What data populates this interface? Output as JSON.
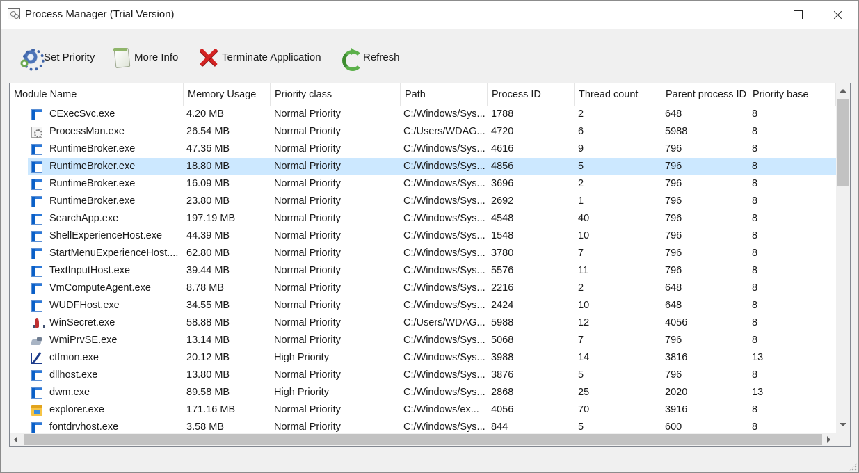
{
  "window": {
    "title": "Process Manager (Trial Version)"
  },
  "toolbar": {
    "set_priority": "Set Priority",
    "more_info": "More Info",
    "terminate": "Terminate Application",
    "refresh": "Refresh"
  },
  "columns": [
    "Module Name",
    "Memory Usage",
    "Priority class",
    "Path",
    "Process ID",
    "Thread count",
    "Parent process ID",
    "Priority base"
  ],
  "selected_row": 3,
  "rows": [
    {
      "icon": "windows-app-icon",
      "name": "CExecSvc.exe",
      "mem": "4.20 MB",
      "prio": "Normal Priority",
      "path": "C:/Windows/Sys...",
      "pid": "1788",
      "threads": "2",
      "ppid": "648",
      "base": "8"
    },
    {
      "icon": "gears-app-icon",
      "name": "ProcessMan.exe",
      "mem": "26.54 MB",
      "prio": "Normal Priority",
      "path": "C:/Users/WDAG...",
      "pid": "4720",
      "threads": "6",
      "ppid": "5988",
      "base": "8"
    },
    {
      "icon": "windows-app-icon",
      "name": "RuntimeBroker.exe",
      "mem": "47.36 MB",
      "prio": "Normal Priority",
      "path": "C:/Windows/Sys...",
      "pid": "4616",
      "threads": "9",
      "ppid": "796",
      "base": "8"
    },
    {
      "icon": "windows-app-icon",
      "name": "RuntimeBroker.exe",
      "mem": "18.80 MB",
      "prio": "Normal Priority",
      "path": "C:/Windows/Sys...",
      "pid": "4856",
      "threads": "5",
      "ppid": "796",
      "base": "8"
    },
    {
      "icon": "windows-app-icon",
      "name": "RuntimeBroker.exe",
      "mem": "16.09 MB",
      "prio": "Normal Priority",
      "path": "C:/Windows/Sys...",
      "pid": "3696",
      "threads": "2",
      "ppid": "796",
      "base": "8"
    },
    {
      "icon": "windows-app-icon",
      "name": "RuntimeBroker.exe",
      "mem": "23.80 MB",
      "prio": "Normal Priority",
      "path": "C:/Windows/Sys...",
      "pid": "2692",
      "threads": "1",
      "ppid": "796",
      "base": "8"
    },
    {
      "icon": "windows-app-icon",
      "name": "SearchApp.exe",
      "mem": "197.19 MB",
      "prio": "Normal Priority",
      "path": "C:/Windows/Sys...",
      "pid": "4548",
      "threads": "40",
      "ppid": "796",
      "base": "8"
    },
    {
      "icon": "windows-app-icon",
      "name": "ShellExperienceHost.exe",
      "mem": "44.39 MB",
      "prio": "Normal Priority",
      "path": "C:/Windows/Sys...",
      "pid": "1548",
      "threads": "10",
      "ppid": "796",
      "base": "8"
    },
    {
      "icon": "windows-app-icon",
      "name": "StartMenuExperienceHost....",
      "mem": "62.80 MB",
      "prio": "Normal Priority",
      "path": "C:/Windows/Sys...",
      "pid": "3780",
      "threads": "7",
      "ppid": "796",
      "base": "8"
    },
    {
      "icon": "windows-app-icon",
      "name": "TextInputHost.exe",
      "mem": "39.44 MB",
      "prio": "Normal Priority",
      "path": "C:/Windows/Sys...",
      "pid": "5576",
      "threads": "11",
      "ppid": "796",
      "base": "8"
    },
    {
      "icon": "windows-app-icon",
      "name": "VmComputeAgent.exe",
      "mem": "8.78 MB",
      "prio": "Normal Priority",
      "path": "C:/Windows/Sys...",
      "pid": "2216",
      "threads": "2",
      "ppid": "648",
      "base": "8"
    },
    {
      "icon": "windows-app-icon",
      "name": "WUDFHost.exe",
      "mem": "34.55 MB",
      "prio": "Normal Priority",
      "path": "C:/Windows/Sys...",
      "pid": "2424",
      "threads": "10",
      "ppid": "648",
      "base": "8"
    },
    {
      "icon": "rocket-icon",
      "name": "WinSecret.exe",
      "mem": "58.88 MB",
      "prio": "Normal Priority",
      "path": "C:/Users/WDAG...",
      "pid": "5988",
      "threads": "12",
      "ppid": "4056",
      "base": "8"
    },
    {
      "icon": "wmi-icon",
      "name": "WmiPrvSE.exe",
      "mem": "13.14 MB",
      "prio": "Normal Priority",
      "path": "C:/Windows/Sys...",
      "pid": "5068",
      "threads": "7",
      "ppid": "796",
      "base": "8"
    },
    {
      "icon": "pen-icon",
      "name": "ctfmon.exe",
      "mem": "20.12 MB",
      "prio": "High Priority",
      "path": "C:/Windows/Sys...",
      "pid": "3988",
      "threads": "14",
      "ppid": "3816",
      "base": "13"
    },
    {
      "icon": "windows-app-icon",
      "name": "dllhost.exe",
      "mem": "13.80 MB",
      "prio": "Normal Priority",
      "path": "C:/Windows/Sys...",
      "pid": "3876",
      "threads": "5",
      "ppid": "796",
      "base": "8"
    },
    {
      "icon": "windows-app-icon",
      "name": "dwm.exe",
      "mem": "89.58 MB",
      "prio": "High Priority",
      "path": "C:/Windows/Sys...",
      "pid": "2868",
      "threads": "25",
      "ppid": "2020",
      "base": "13"
    },
    {
      "icon": "folder-icon",
      "name": "explorer.exe",
      "mem": "171.16 MB",
      "prio": "Normal Priority",
      "path": "C:/Windows/ex...",
      "pid": "4056",
      "threads": "70",
      "ppid": "3916",
      "base": "8"
    },
    {
      "icon": "windows-app-icon",
      "name": "fontdrvhost.exe",
      "mem": "3.58 MB",
      "prio": "Normal Priority",
      "path": "C:/Windows/Sys...",
      "pid": "844",
      "threads": "5",
      "ppid": "600",
      "base": "8"
    }
  ]
}
